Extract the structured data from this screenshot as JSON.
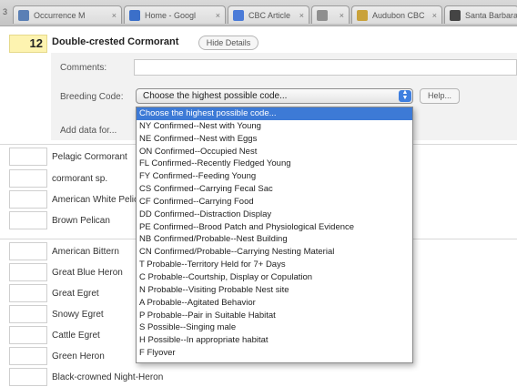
{
  "browser": {
    "tab_number": "3",
    "tabs": [
      {
        "label": "Occurrence M",
        "color": "#5a7fb5"
      },
      {
        "label": "Home - Googl",
        "color": "#3b6fc9"
      },
      {
        "label": "CBC Article",
        "color": "#4b7bd8"
      },
      {
        "label": "",
        "color": "#8f8f8f"
      },
      {
        "label": "Audubon CBC",
        "color": "#c9a23b"
      },
      {
        "label": "Santa Barbara",
        "color": "#444444"
      }
    ]
  },
  "entry": {
    "number": "12",
    "species": "Double-crested Cormorant",
    "hide_details_label": "Hide Details",
    "comments_label": "Comments:",
    "breeding_code_label": "Breeding Code:",
    "add_data_label": "Add data for...",
    "help_label": "Help..."
  },
  "breeding_select": {
    "selected": "Choose the highest possible code...",
    "options": [
      "Choose the highest possible code...",
      "NY Confirmed--Nest with Young",
      "NE Confirmed--Nest with Eggs",
      "ON Confirmed--Occupied Nest",
      "FL Confirmed--Recently Fledged Young",
      "FY Confirmed--Feeding Young",
      "CS Confirmed--Carrying Fecal Sac",
      "CF Confirmed--Carrying Food",
      "DD Confirmed--Distraction Display",
      "PE Confirmed--Brood Patch and Physiological Evidence",
      "NB Confirmed/Probable--Nest Building",
      "CN Confirmed/Probable--Carrying Nesting Material",
      "T Probable--Territory Held for 7+ Days",
      "C Probable--Courtship, Display or Copulation",
      "N Probable--Visiting Probable Nest site",
      "A Probable--Agitated Behavior",
      "P Probable--Pair in Suitable Habitat",
      "S Possible--Singing male",
      "H Possible--In appropriate habitat",
      "F Flyover"
    ]
  },
  "species_list": {
    "group1": [
      "Pelagic Cormorant",
      "cormorant sp.",
      "American White Pelican",
      "Brown Pelican"
    ],
    "group2": [
      "American Bittern",
      "Great Blue Heron",
      "Great Egret",
      "Snowy Egret",
      "Cattle Egret",
      "Green Heron",
      "Black-crowned Night-Heron"
    ]
  },
  "colors": {
    "highlight": "#fdf3b0",
    "selection": "#3d7ad6"
  }
}
